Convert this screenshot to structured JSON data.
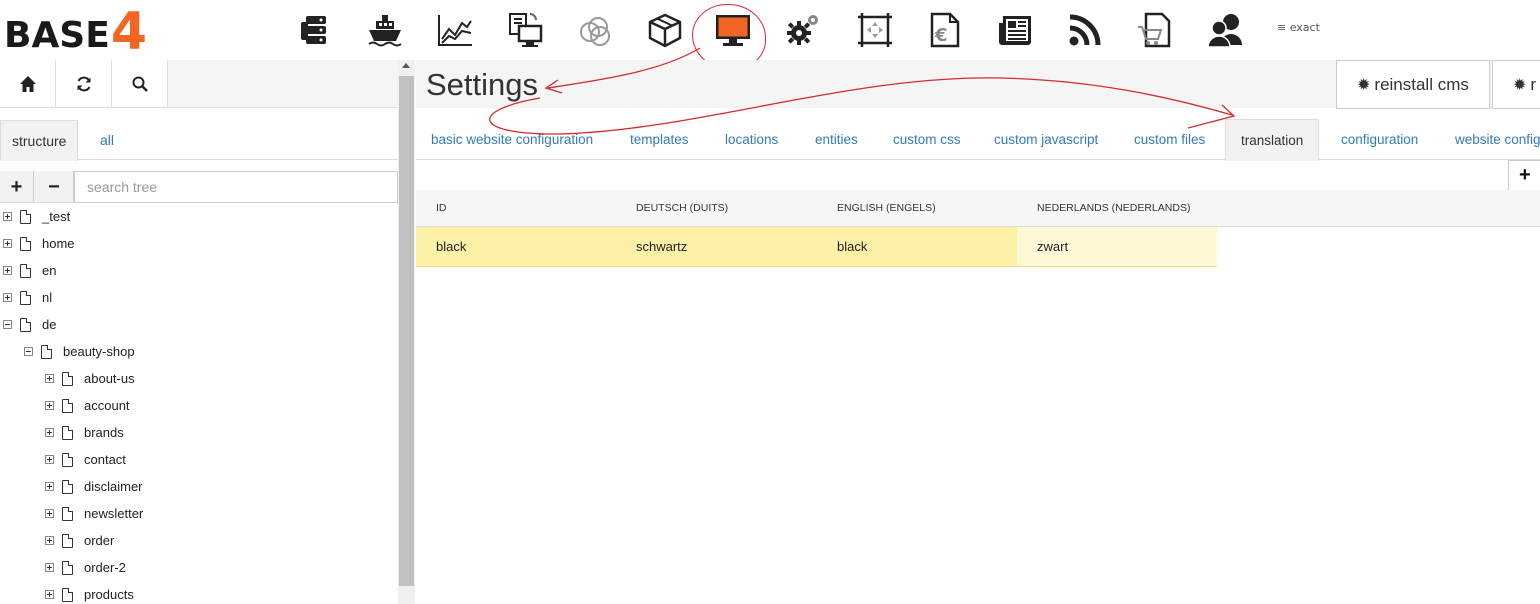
{
  "logo": {
    "text": "BASE",
    "number": "4"
  },
  "top_modules": [
    {
      "name": "servers-icon"
    },
    {
      "name": "ship-icon"
    },
    {
      "name": "chart-icon"
    },
    {
      "name": "documents-screen-icon"
    },
    {
      "name": "circles-icon"
    },
    {
      "name": "box-icon"
    },
    {
      "name": "monitor-icon",
      "active": true
    },
    {
      "name": "gears-icon"
    },
    {
      "name": "crop-frame-icon"
    },
    {
      "name": "euro-document-icon"
    },
    {
      "name": "newspaper-icon"
    },
    {
      "name": "rss-icon"
    },
    {
      "name": "cart-document-icon"
    },
    {
      "name": "users-icon"
    }
  ],
  "exact_label": "≡ exact",
  "left_panel": {
    "tabs": [
      {
        "label": "structure",
        "active": true
      },
      {
        "label": "all",
        "active": false
      }
    ],
    "search_placeholder": "search tree",
    "add_label": "+",
    "remove_label": "−",
    "tree": [
      {
        "label": "_test",
        "depth": 0,
        "expanded": false
      },
      {
        "label": "home",
        "depth": 0,
        "expanded": false
      },
      {
        "label": "en",
        "depth": 0,
        "expanded": false
      },
      {
        "label": "nl",
        "depth": 0,
        "expanded": false
      },
      {
        "label": "de",
        "depth": 0,
        "expanded": true
      },
      {
        "label": "beauty-shop",
        "depth": 1,
        "expanded": true
      },
      {
        "label": "about-us",
        "depth": 2,
        "expanded": false
      },
      {
        "label": "account",
        "depth": 2,
        "expanded": false
      },
      {
        "label": "brands",
        "depth": 2,
        "expanded": false
      },
      {
        "label": "contact",
        "depth": 2,
        "expanded": false
      },
      {
        "label": "disclaimer",
        "depth": 2,
        "expanded": false
      },
      {
        "label": "newsletter",
        "depth": 2,
        "expanded": false
      },
      {
        "label": "order",
        "depth": 2,
        "expanded": false
      },
      {
        "label": "order-2",
        "depth": 2,
        "expanded": false
      },
      {
        "label": "products",
        "depth": 2,
        "expanded": false
      }
    ]
  },
  "main": {
    "title": "Settings",
    "header_buttons": [
      {
        "label": "reinstall cms"
      },
      {
        "label": "r"
      }
    ],
    "tabs": [
      {
        "label": "basic website configuration",
        "active": false
      },
      {
        "label": "templates",
        "active": false
      },
      {
        "label": "locations",
        "active": false
      },
      {
        "label": "entities",
        "active": false
      },
      {
        "label": "custom css",
        "active": false
      },
      {
        "label": "custom javascript",
        "active": false
      },
      {
        "label": "custom files",
        "active": false
      },
      {
        "label": "translation",
        "active": true
      },
      {
        "label": "configuration",
        "active": false
      },
      {
        "label": "website config",
        "active": false
      }
    ],
    "add_label": "+",
    "table": {
      "headers": [
        "ID",
        "DEUTSCH (DUITS)",
        "ENGLISH (ENGELS)",
        "NEDERLANDS (NEDERLANDS)"
      ],
      "rows": [
        [
          "black",
          "schwartz",
          "black",
          "zwart"
        ]
      ]
    }
  },
  "colors": {
    "accent_orange": "#f26522",
    "link_blue": "#337ab7",
    "row_highlight": "#fdf1a8",
    "annotation_red": "#d42b2b"
  }
}
